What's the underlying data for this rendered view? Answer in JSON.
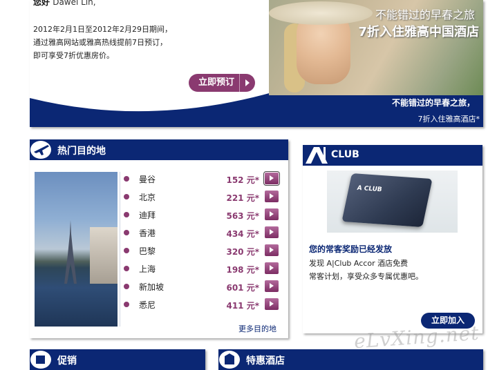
{
  "banner": {
    "greeting": "您好",
    "greeting_name": "Dawei Lin,",
    "body_line1": "2012年2月1日至2012年2月29日期间，",
    "body_line2": "通过雅高网站或雅高热线提前7日预订，",
    "body_line3": "即可享受7折优惠房价。",
    "book_button": "立即预订",
    "photo_title1": "不能错过的早春之旅",
    "photo_title2": "7折入住雅高中国酒店",
    "caption1": "不能错过的早春之旅，",
    "caption2": "7折入住雅高酒店*"
  },
  "destinations": {
    "title": "热门目的地",
    "more_link": "更多目的地",
    "items": [
      {
        "city": "曼谷",
        "price": "152 元*"
      },
      {
        "city": "北京",
        "price": "221 元*"
      },
      {
        "city": "迪拜",
        "price": "563 元*"
      },
      {
        "city": "香港",
        "price": "434 元*"
      },
      {
        "city": "巴黎",
        "price": "320 元*"
      },
      {
        "city": "上海",
        "price": "198 元*"
      },
      {
        "city": "新加坡",
        "price": "601 元*"
      },
      {
        "city": "悉尼",
        "price": "411 元*"
      }
    ]
  },
  "club": {
    "title": "CLUB",
    "card_label": "A CLUB",
    "headline": "您的常客奖励已经发放",
    "desc_line1": "发现 A|Club Accor 酒店免费",
    "desc_line2": "常客计划，享受众多专属优惠吧。",
    "join_button": "立即加入"
  },
  "promo": {
    "title": "促销"
  },
  "special_hotel": {
    "title": "特惠酒店"
  },
  "watermark": "eLvXing.net",
  "colors": {
    "navy": "#0b2774",
    "plum": "#8a3a70"
  }
}
